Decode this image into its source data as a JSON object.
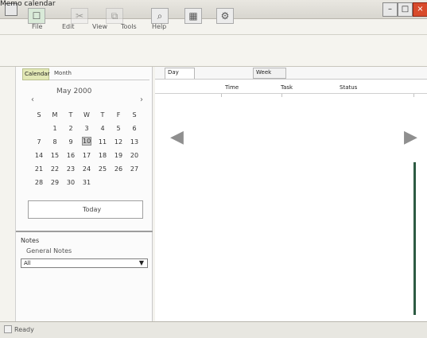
{
  "window": {
    "title": "Memo calendar"
  },
  "menu": [
    "File",
    "Edit",
    "View",
    "Tools",
    "Help"
  ],
  "toolbar": {
    "icons": [
      "new-icon",
      "cut-icon",
      "copy-icon",
      "search-icon",
      "calendar-icon",
      "settings-icon"
    ]
  },
  "calendar": {
    "tabs": [
      "Calendar",
      "Month"
    ],
    "month_label": "May 2000",
    "weekdays": [
      "S",
      "M",
      "T",
      "W",
      "T",
      "F",
      "S"
    ],
    "days": [
      [
        "",
        "1",
        "2",
        "3",
        "4",
        "5",
        "6"
      ],
      [
        "7",
        "8",
        "9",
        "10",
        "11",
        "12",
        "13"
      ],
      [
        "14",
        "15",
        "16",
        "17",
        "18",
        "19",
        "20"
      ],
      [
        "21",
        "22",
        "23",
        "24",
        "25",
        "26",
        "27"
      ],
      [
        "28",
        "29",
        "30",
        "31",
        "",
        "",
        ""
      ]
    ],
    "selected_day": "10",
    "today_label": "Today"
  },
  "notes": {
    "title": "Notes",
    "subtitle": "General Notes",
    "selected": "All"
  },
  "main": {
    "tabs": [
      "Day",
      "Week"
    ],
    "columns": [
      "Time",
      "Task",
      "Status"
    ]
  },
  "status": {
    "text": "Ready"
  }
}
